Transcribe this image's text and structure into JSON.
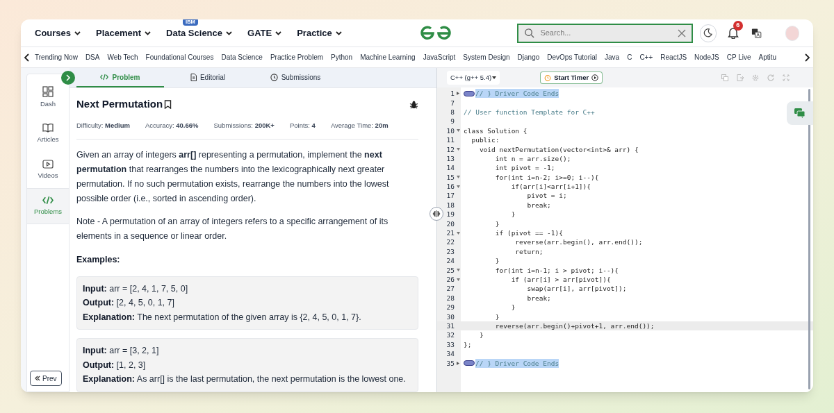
{
  "top_nav": {
    "menus": [
      {
        "label": "Courses"
      },
      {
        "label": "Placement"
      },
      {
        "label": "Data Science",
        "badge": "IBM"
      },
      {
        "label": "GATE"
      },
      {
        "label": "Practice"
      }
    ],
    "search": {
      "placeholder": "Search..."
    },
    "notifications": "6"
  },
  "category_nav": [
    "Trending Now",
    "DSA",
    "Web Tech",
    "Foundational Courses",
    "Data Science",
    "Practice Problem",
    "Python",
    "Machine Learning",
    "JavaScript",
    "System Design",
    "Django",
    "DevOps Tutorial",
    "Java",
    "C",
    "C++",
    "ReactJS",
    "NodeJS",
    "CP Live",
    "Aptitu"
  ],
  "sidebar": {
    "items": [
      {
        "label": "Dash",
        "selected": false
      },
      {
        "label": "Articles",
        "selected": false
      },
      {
        "label": "Videos",
        "selected": false
      },
      {
        "label": "Problems",
        "selected": true
      }
    ],
    "prev_button": "Prev"
  },
  "tabs": [
    {
      "label": "Problem",
      "selected": true
    },
    {
      "label": "Editorial",
      "selected": false
    },
    {
      "label": "Submissions",
      "selected": false
    }
  ],
  "problem": {
    "title": "Next Permutation",
    "stats": [
      {
        "label": "Difficulty:",
        "value": "Medium"
      },
      {
        "label": "Accuracy:",
        "value": "40.66%"
      },
      {
        "label": "Submissions:",
        "value": "200K+"
      },
      {
        "label": "Points:",
        "value": "4"
      },
      {
        "label": "Average Time:",
        "value": "20m"
      }
    ],
    "description": "Given an array of integers **arr[]** representing a permutation, implement the **next permutation** that rearranges the numbers into the lexicographically next greater permutation. If no such permutation exists, rearrange the numbers into the lowest possible order (i.e., sorted in ascending order).",
    "note": "Note - A permutation of an array of integers refers to a specific arrangement of its elements in a sequence or linear order.",
    "examples_heading": "Examples:",
    "examples": [
      {
        "lines": [
          {
            "label": "Input:",
            "text": "arr = [2, 4, 1, 7, 5, 0]"
          },
          {
            "label": "Output:",
            "text": "[2, 4, 5, 0, 1, 7]"
          },
          {
            "label": "Explanation:",
            "text": "The next permutation of the given array is {2, 4, 5, 0, 1, 7}."
          }
        ]
      },
      {
        "lines": [
          {
            "label": "Input:",
            "text": "arr = [3, 2, 1]"
          },
          {
            "label": "Output:",
            "text": "[1, 2, 3]"
          },
          {
            "label": "Explanation:",
            "text": "As arr[] is the last permutation, the next permutation is the lowest one."
          }
        ]
      }
    ]
  },
  "editor": {
    "language": "C++ (g++ 5.4)",
    "timer": "Start Timer",
    "lines": [
      {
        "number": "1",
        "text": "// } Driver Code Ends",
        "kind": "folded",
        "selected": true
      },
      {
        "number": "7",
        "kind": "code"
      },
      {
        "number": "8",
        "text": "// User function Template for C++",
        "kind": "comment"
      },
      {
        "number": "9",
        "kind": "code"
      },
      {
        "number": "10",
        "text": "class Solution {",
        "kind": "code",
        "foldable": true
      },
      {
        "number": "11",
        "text": "  public:",
        "kind": "code"
      },
      {
        "number": "12",
        "text": "    void nextPermutation(vector<int>& arr) {",
        "kind": "code",
        "foldable": true
      },
      {
        "number": "13",
        "text": "        int n = arr.size();",
        "kind": "code"
      },
      {
        "number": "14",
        "text": "        int pivot = -1;",
        "kind": "code"
      },
      {
        "number": "15",
        "text": "        for(int i=n-2; i>=0; i--){",
        "kind": "code",
        "foldable": true
      },
      {
        "number": "16",
        "text": "            if(arr[i]<arr[i+1]){",
        "kind": "code",
        "foldable": true
      },
      {
        "number": "17",
        "text": "                pivot = i;",
        "kind": "code"
      },
      {
        "number": "18",
        "text": "                break;",
        "kind": "code"
      },
      {
        "number": "19",
        "text": "            }",
        "kind": "code"
      },
      {
        "number": "20",
        "text": "        }",
        "kind": "code"
      },
      {
        "number": "21",
        "text": "        if (pivot == -1){",
        "kind": "code",
        "foldable": true
      },
      {
        "number": "22",
        "text": "             reverse(arr.begin(), arr.end());",
        "kind": "code"
      },
      {
        "number": "23",
        "text": "             return;",
        "kind": "code"
      },
      {
        "number": "24",
        "text": "        }",
        "kind": "code"
      },
      {
        "number": "25",
        "text": "        for(int i=n-1; i > pivot; i--){",
        "kind": "code",
        "foldable": true
      },
      {
        "number": "26",
        "text": "            if (arr[i] > arr[pivot]){",
        "kind": "code",
        "foldable": true
      },
      {
        "number": "27",
        "text": "                swap(arr[i], arr[pivot]);",
        "kind": "code"
      },
      {
        "number": "28",
        "text": "                break;",
        "kind": "code"
      },
      {
        "number": "29",
        "text": "            }",
        "kind": "code"
      },
      {
        "number": "30",
        "text": "        }",
        "kind": "code"
      },
      {
        "number": "31",
        "text": "        reverse(arr.begin()+pivot+1, arr.end());",
        "kind": "code",
        "current": true
      },
      {
        "number": "32",
        "text": "    }",
        "kind": "code"
      },
      {
        "number": "33",
        "text": "};",
        "kind": "code"
      },
      {
        "number": "34",
        "kind": "code"
      },
      {
        "number": "35",
        "text": "// } Driver Code Ends",
        "kind": "folded",
        "selected": true
      }
    ]
  }
}
